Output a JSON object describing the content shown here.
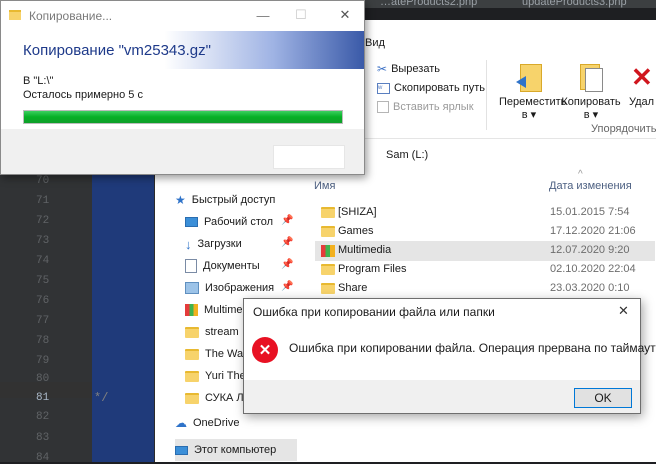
{
  "editor": {
    "tabs": [
      "…ateProducts2.php",
      "updateProducts3.php"
    ],
    "line_numbers": [
      "70",
      "71",
      "72",
      "73",
      "74",
      "75",
      "76",
      "77",
      "78",
      "79",
      "80",
      "81",
      "82",
      "83",
      "84"
    ],
    "current_line": "81",
    "code_fragment": "*/"
  },
  "copy_dialog": {
    "window_title": "Копирование...",
    "header": "Копирование \"vm25343.gz\"",
    "destination": "В \"L:\\\"",
    "time_left": "Осталось примерно 5 с",
    "progress_percent": 100,
    "accent_color": "#06b025"
  },
  "explorer": {
    "ribbon_tab_view": "Вид",
    "cut_label": "Вырезать",
    "copy_path_label": "Скопировать путь",
    "paste_shortcut_label": "Вставить ярлык",
    "move_to_label": "Переместить",
    "move_to_sub": "в ▾",
    "copy_to_label": "Копировать",
    "copy_to_sub": "в ▾",
    "delete_label": "Удал",
    "group_label": "Упорядочить",
    "breadcrumb_sep": "›",
    "breadcrumb": "Sam (L:)",
    "column_name": "Имя",
    "column_date": "Дата изменения",
    "nav": {
      "quick_access": "Быстрый доступ",
      "items": [
        {
          "label": "Рабочий стол",
          "icon": "desktop-icon",
          "pinned": true
        },
        {
          "label": "Загрузки",
          "icon": "download-icon",
          "pinned": true
        },
        {
          "label": "Документы",
          "icon": "documents-icon",
          "pinned": true
        },
        {
          "label": "Изображения",
          "icon": "pictures-icon",
          "pinned": true
        },
        {
          "label": "Multime",
          "icon": "multimedia-folder-icon",
          "pinned": false
        },
        {
          "label": "stream",
          "icon": "folder-icon",
          "pinned": false
        },
        {
          "label": "The Wal",
          "icon": "folder-icon",
          "pinned": false
        },
        {
          "label": "Yuri The",
          "icon": "folder-icon",
          "pinned": false
        },
        {
          "label": "СУКА Л",
          "icon": "folder-icon",
          "pinned": false
        }
      ],
      "onedrive": "OneDrive",
      "this_pc": "Этот компьютер"
    },
    "files": [
      {
        "name": "[SHIZA]",
        "date": "15.01.2015 7:54",
        "selected": false,
        "icon": "folder-icon"
      },
      {
        "name": "Games",
        "date": "17.12.2020 21:06",
        "selected": false,
        "icon": "folder-icon"
      },
      {
        "name": "Multimedia",
        "date": "12.07.2020 9:20",
        "selected": true,
        "icon": "multimedia-folder-icon"
      },
      {
        "name": "Program Files",
        "date": "02.10.2020 22:04",
        "selected": false,
        "icon": "folder-icon"
      },
      {
        "name": "Share",
        "date": "23.03.2020 0:10",
        "selected": false,
        "icon": "folder-icon"
      }
    ]
  },
  "error_dialog": {
    "title": "Ошибка при копировании файла или папки",
    "message": "Ошибка при копировании файла. Операция прервана по таймауту",
    "ok_label": "OK",
    "close_glyph": "✕",
    "icon": "error-icon",
    "icon_color": "#e81123"
  }
}
